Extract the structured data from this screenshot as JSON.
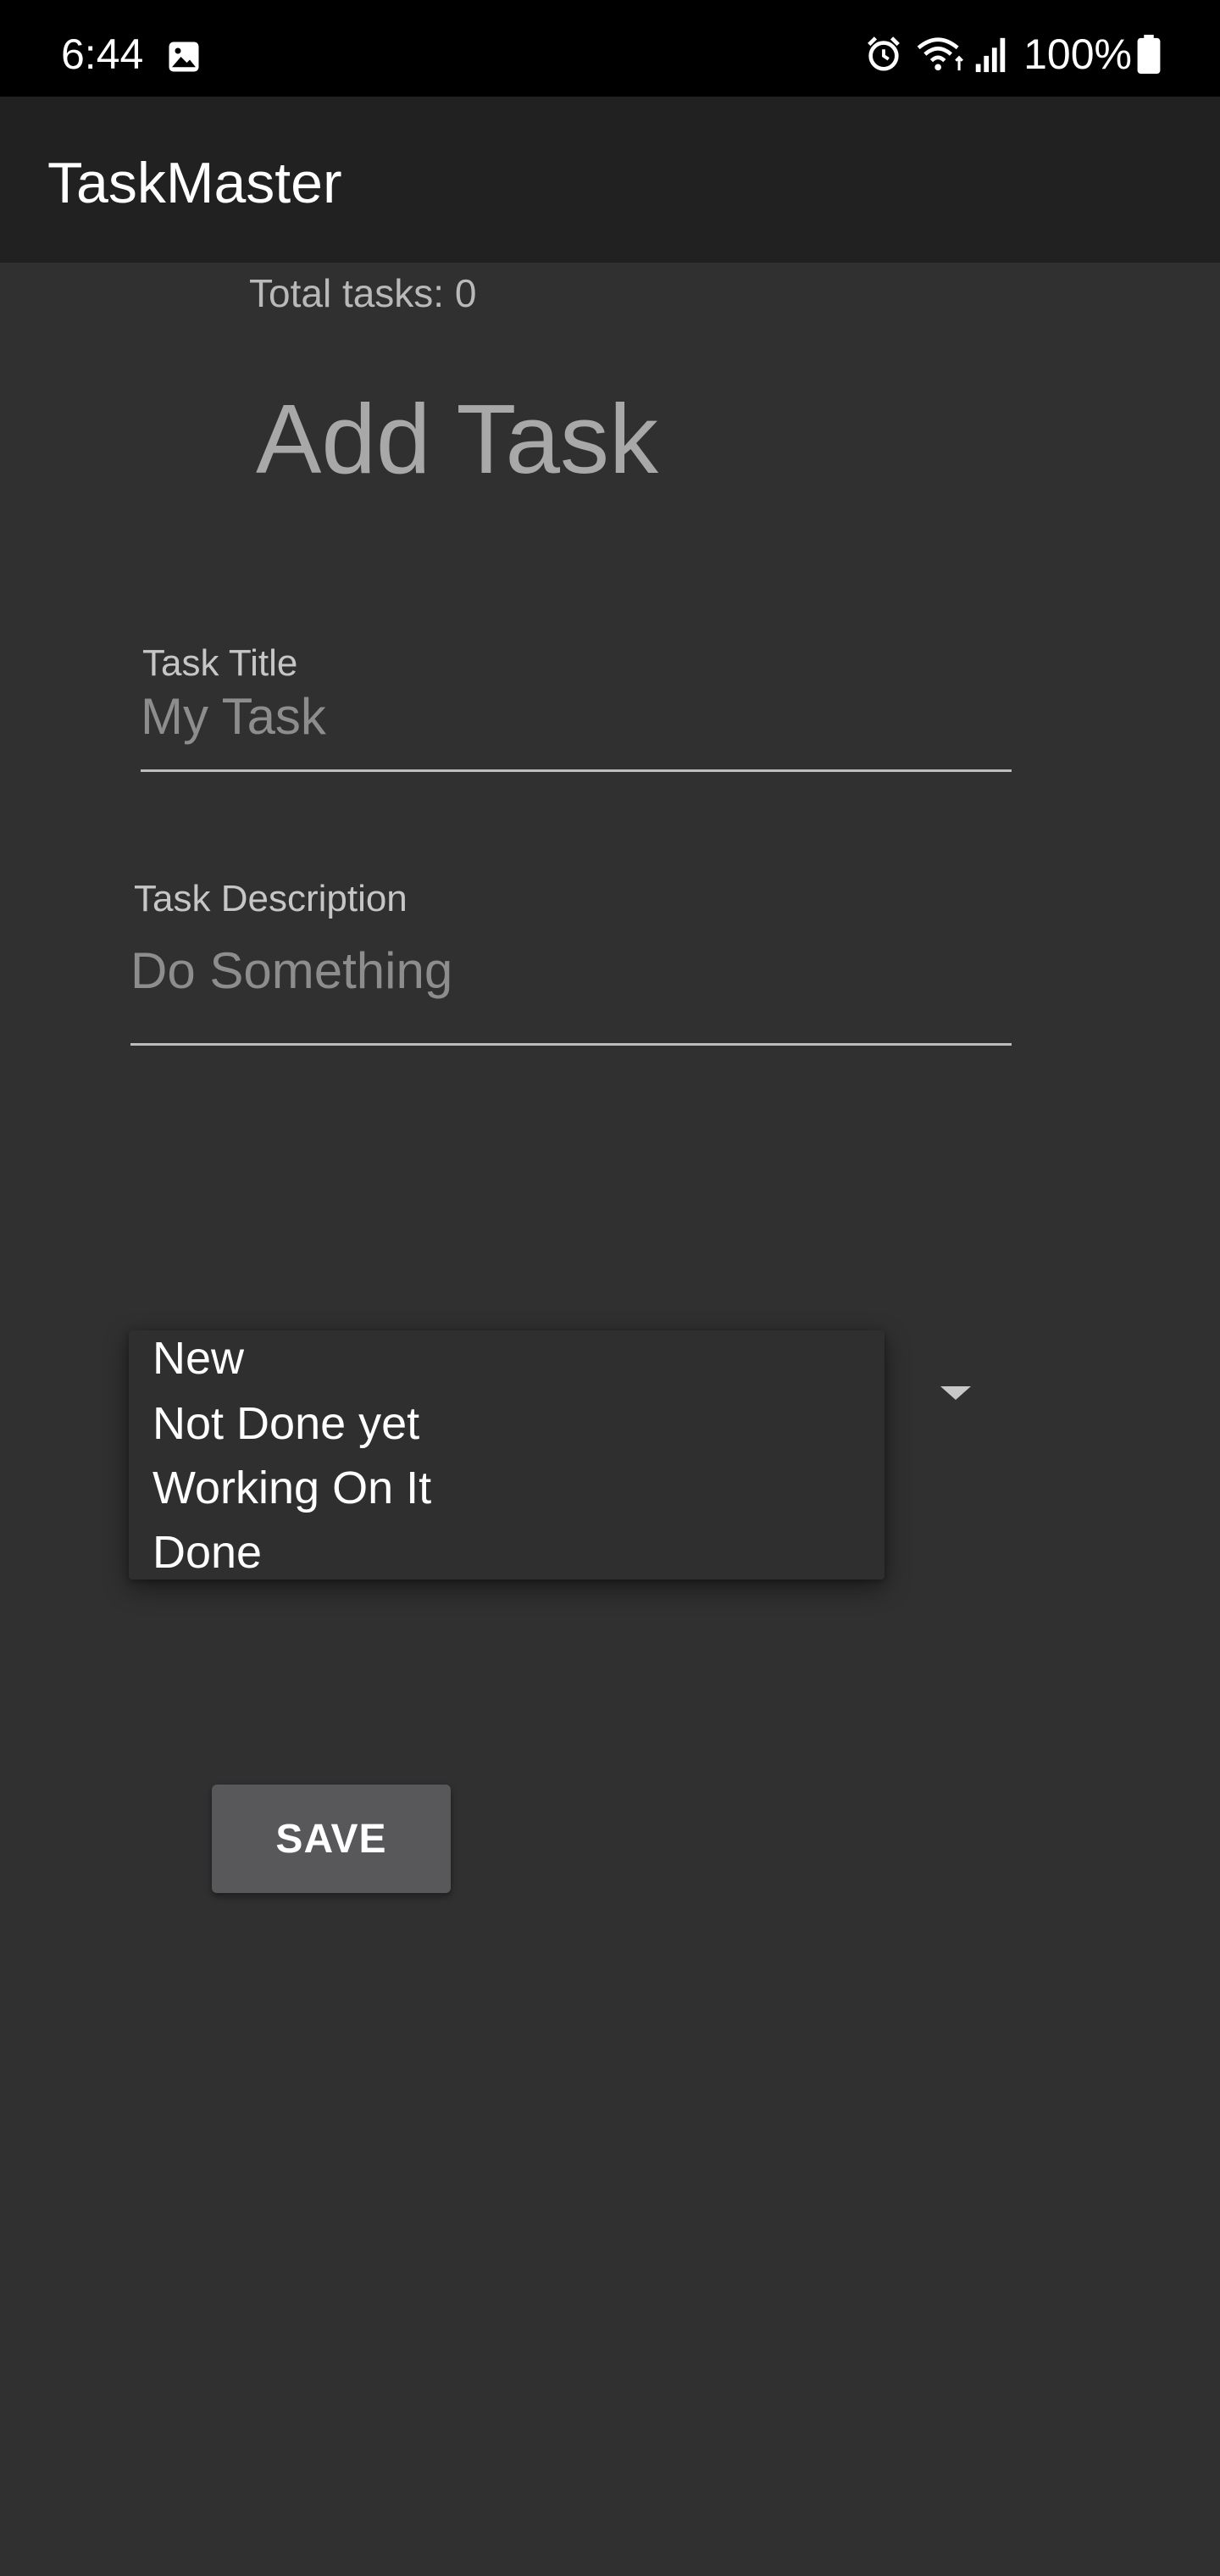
{
  "status_bar": {
    "time": "6:44",
    "battery": "100%",
    "icons": [
      "gallery-icon",
      "alarm-icon",
      "wifi-icon",
      "signal-icon",
      "battery-icon"
    ]
  },
  "app_bar": {
    "title": "TaskMaster"
  },
  "main": {
    "total_tasks": "Total tasks: 0",
    "heading": "Add Task",
    "task_title": {
      "label": "Task Title",
      "placeholder": "My Task"
    },
    "task_description": {
      "label": "Task Description",
      "placeholder": "Do Something"
    },
    "status_dropdown": {
      "options": [
        "New",
        "Not Done yet",
        "Working On It",
        "Done"
      ],
      "arrow_icon": "dropdown-arrow-icon"
    },
    "save_label": "SAVE"
  },
  "colors": {
    "background": "#303030",
    "app_bar": "#212121",
    "status_bar": "#000000",
    "button": "#58585a"
  }
}
